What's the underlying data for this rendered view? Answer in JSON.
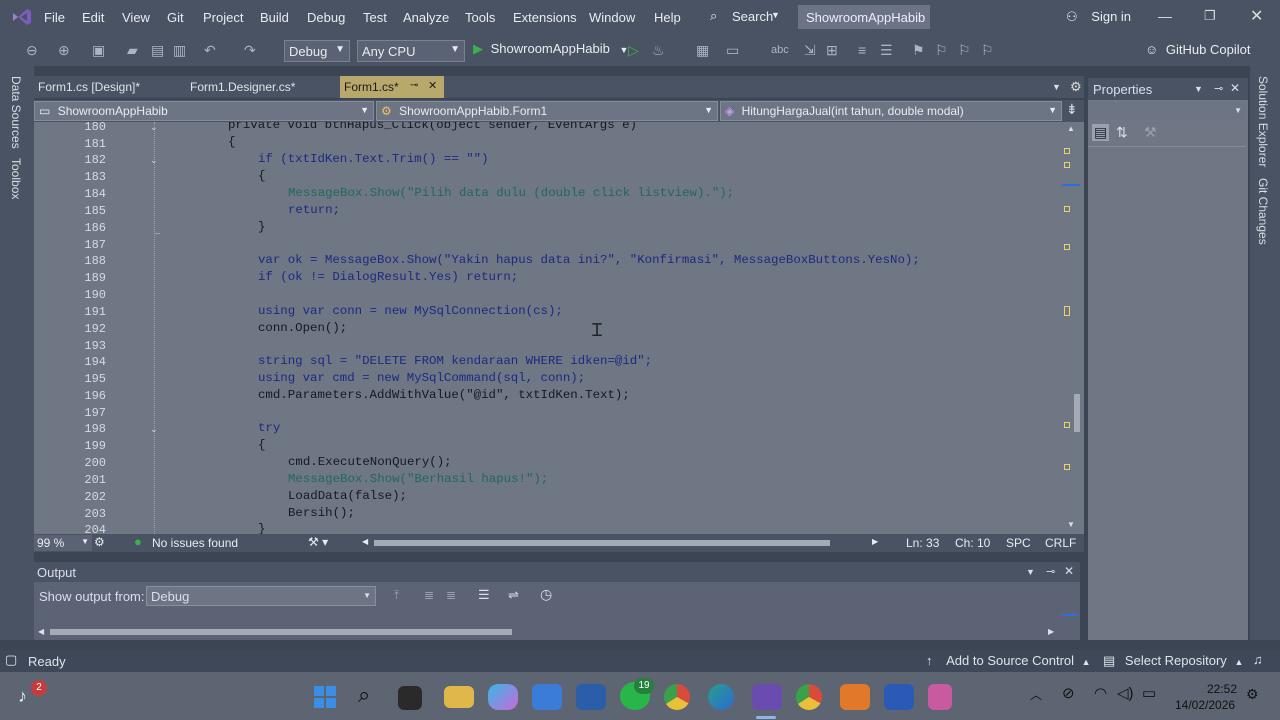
{
  "menu": {
    "items": [
      "File",
      "Edit",
      "View",
      "Git",
      "Project",
      "Build",
      "Debug",
      "Test",
      "Analyze",
      "Tools",
      "Extensions",
      "Window",
      "Help"
    ],
    "search": "Search",
    "solution": "ShowroomAppHabib",
    "signin": "Sign in"
  },
  "toolbar": {
    "config": "Debug",
    "platform": "Any CPU",
    "run_target": "ShowroomAppHabib",
    "copilot": "GitHub Copilot"
  },
  "left_tabs": [
    "Data Sources",
    "Toolbox"
  ],
  "right_tabs": [
    "Solution Explorer",
    "Git Changes"
  ],
  "tabs": [
    {
      "label": "Form1.cs [Design]*"
    },
    {
      "label": "Form1.Designer.cs*"
    },
    {
      "label": "Form1.cs*"
    }
  ],
  "nav": {
    "project": "ShowroomAppHabib",
    "type": "ShowroomAppHabib.Form1",
    "member": "HitungHargaJual(int tahun, double modal)"
  },
  "code_lines": [
    {
      "n": "180",
      "text": "private void btnHapus_Click(object sender, EventArgs e)"
    },
    {
      "n": "181",
      "text": "{"
    },
    {
      "n": "182",
      "text": "if (txtIdKen.Text.Trim() == \"\")"
    },
    {
      "n": "183",
      "text": "{"
    },
    {
      "n": "184",
      "text": "MessageBox.Show(\"Pilih data dulu (double click listview).\");"
    },
    {
      "n": "185",
      "text": "return;"
    },
    {
      "n": "186",
      "text": "}"
    },
    {
      "n": "187",
      "text": ""
    },
    {
      "n": "188",
      "text": "var ok = MessageBox.Show(\"Yakin hapus data ini?\", \"Konfirmasi\", MessageBoxButtons.YesNo);"
    },
    {
      "n": "189",
      "text": "if (ok != DialogResult.Yes) return;"
    },
    {
      "n": "190",
      "text": ""
    },
    {
      "n": "191",
      "text": "using var conn = new MySqlConnection(cs);"
    },
    {
      "n": "192",
      "text": "conn.Open();"
    },
    {
      "n": "193",
      "text": ""
    },
    {
      "n": "194",
      "text": "string sql = \"DELETE FROM kendaraan WHERE idken=@id\";"
    },
    {
      "n": "195",
      "text": "using var cmd = new MySqlCommand(sql, conn);"
    },
    {
      "n": "196",
      "text": "cmd.Parameters.AddWithValue(\"@id\", txtIdKen.Text);"
    },
    {
      "n": "197",
      "text": ""
    },
    {
      "n": "198",
      "text": "try"
    },
    {
      "n": "199",
      "text": "{"
    },
    {
      "n": "200",
      "text": "cmd.ExecuteNonQuery();"
    },
    {
      "n": "201",
      "text": "MessageBox.Show(\"Berhasil hapus!\");"
    },
    {
      "n": "202",
      "text": "LoadData(false);"
    },
    {
      "n": "203",
      "text": "Bersih();"
    },
    {
      "n": "204",
      "text": "}"
    }
  ],
  "editor_status": {
    "zoom": "99 %",
    "issues": "No issues found",
    "line": "Ln: 33",
    "col": "Ch: 10",
    "spc": "SPC",
    "eol": "CRLF"
  },
  "output": {
    "title": "Output",
    "show_from_label": "Show output from:",
    "source": "Debug"
  },
  "properties": {
    "title": "Properties"
  },
  "statusbar": {
    "ready": "Ready",
    "add_source": "Add to Source Control",
    "select_repo": "Select Repository"
  },
  "taskbar": {
    "badge_notif": "2",
    "whatsapp_badge": "19",
    "time": "22:52",
    "date": "14/02/2026"
  }
}
